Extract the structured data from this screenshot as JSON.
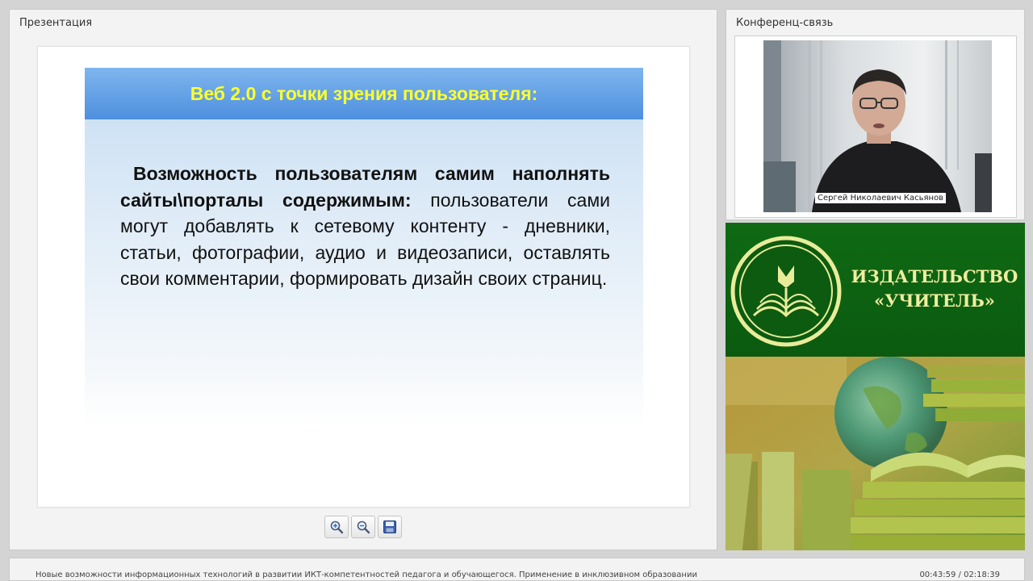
{
  "presentation": {
    "title": "Презентация",
    "slide": {
      "heading": "Веб 2.0 с точки зрения пользователя:",
      "lead": "Возможность пользователям самим наполнять сайты\\порталы содержимым:",
      "body": " пользователи сами могут добавлять к сетевому контенту - дневники, статьи, фотографии, аудио и видеозаписи, оставлять свои комментарии, формировать дизайн своих страниц."
    },
    "toolbar": {
      "zoom_in_icon": "zoom-in-icon",
      "zoom_out_icon": "zoom-out-icon",
      "save_icon": "floppy-disk-icon"
    }
  },
  "conference": {
    "title": "Конференц-связь",
    "speaker_name": "Сергей Николаевич Касьянов"
  },
  "publisher": {
    "name_line1": "ИЗДАТЕЛЬСТВО",
    "name_line2": "«УЧИТЕЛЬ»"
  },
  "status": {
    "course_title": "Новые возможности информационных технологий в развитии ИКТ-компетентностей педагога и обучающегося. Применение в инклюзивном образовании",
    "time": "00:43:59 / 02:18:39"
  },
  "colors": {
    "slide_title": "#ffff2a",
    "slide_header": "#4d8fde",
    "publisher_green": "#0f6a13",
    "publisher_text": "#f1eda0"
  }
}
